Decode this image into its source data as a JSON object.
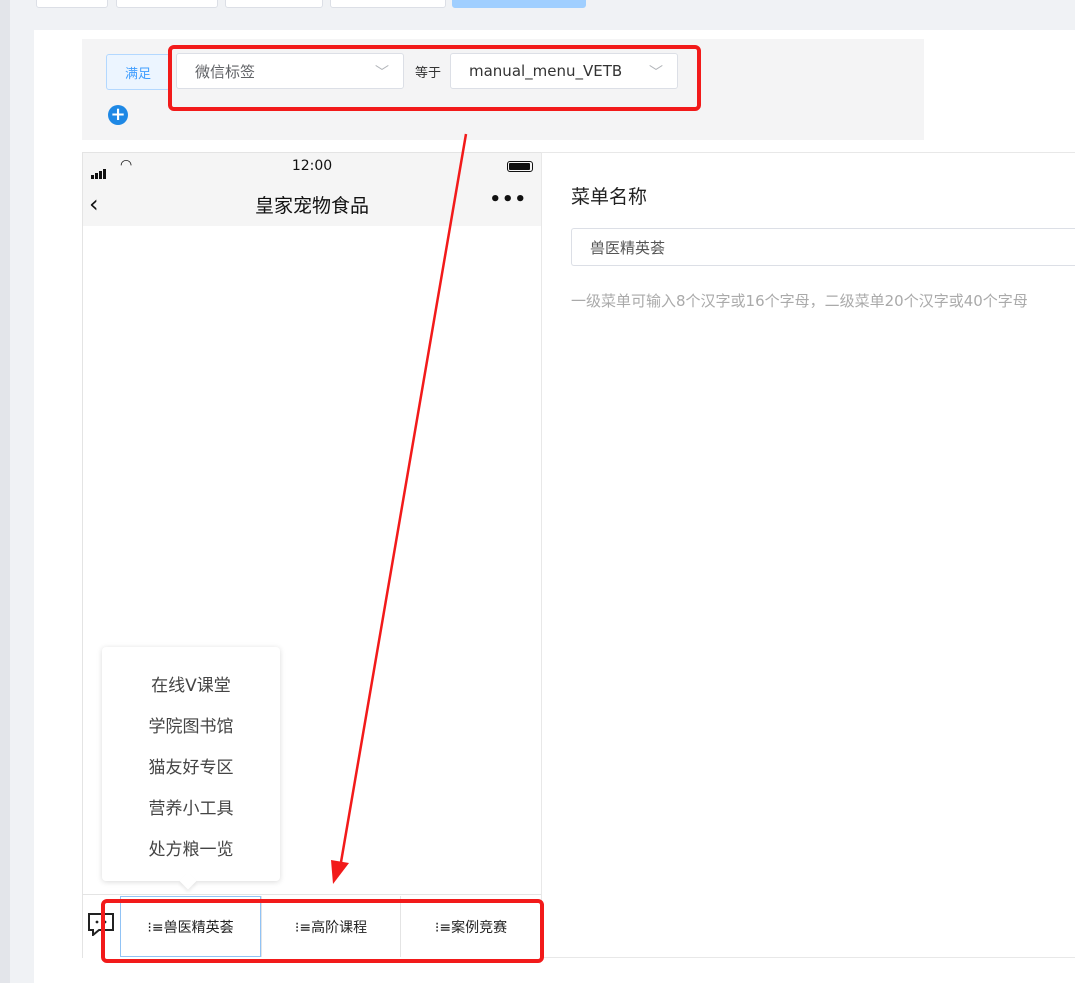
{
  "condition": {
    "match_label": "满足",
    "field_select": "微信标签",
    "operator_label": "等于",
    "value_select": "manual_menu_VETB",
    "add_icon": "plus-circle-icon"
  },
  "phone": {
    "time": "12:00",
    "title": "皇家宠物食品",
    "back_icon": "chevron-left-icon",
    "more_icon": "more-dots-icon",
    "submenu": [
      "在线V课堂",
      "学院图书馆",
      "猫友好专区",
      "营养小工具",
      "处方粮一览"
    ],
    "keyboard_icon": "chat-keyboard-icon",
    "menus": [
      "⁝≡兽医精英荟",
      "⁝≡高阶课程",
      "⁝≡案例竞赛"
    ]
  },
  "form": {
    "name_label": "菜单名称",
    "name_value": "兽医精英荟",
    "hint": "一级菜单可输入8个汉字或16个字母，二级菜单20个汉字或40个字母"
  },
  "colors": {
    "accent": "#409eff",
    "annotation_red": "#f21a1a"
  }
}
